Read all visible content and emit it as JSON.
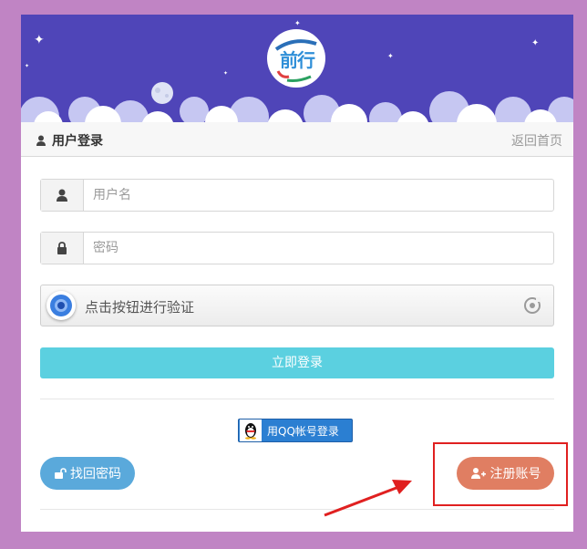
{
  "logo": {
    "text": "前行"
  },
  "header": {
    "title": "用户登录",
    "back_link": "返回首页"
  },
  "form": {
    "username_placeholder": "用户名",
    "password_placeholder": "密码",
    "captcha_text": "点击按钮进行验证",
    "login_label": "立即登录"
  },
  "social": {
    "qq_label": "用QQ帐号登录"
  },
  "actions": {
    "forgot_label": "找回密码",
    "register_label": "注册账号"
  },
  "colors": {
    "page_bg": "#c084c4",
    "banner_bg": "#4f45b8",
    "login_btn": "#5bd0e0",
    "forgot_btn": "#5aa9db",
    "register_btn": "#e07e62",
    "annotation": "#e02020"
  },
  "icons": {
    "header": "user-icon",
    "username": "user-icon",
    "password": "lock-icon",
    "captcha": "captcha-circle-icon",
    "refresh": "refresh-icon",
    "qq": "qq-penguin-icon",
    "forgot": "unlock-icon",
    "register": "add-user-icon"
  }
}
